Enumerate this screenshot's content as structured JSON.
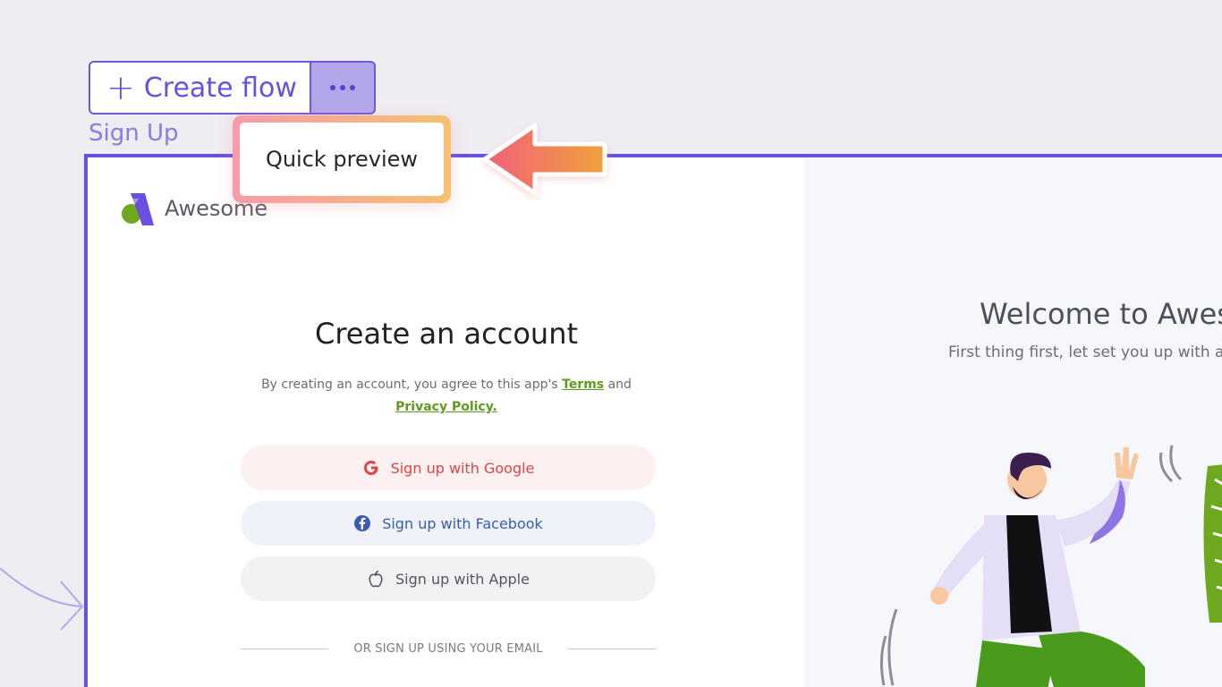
{
  "toolbar": {
    "create_label": "Create flow",
    "plus_glyph": "+",
    "more_icon": "more-horizontal-icon"
  },
  "flow": {
    "label": "Sign Up"
  },
  "tooltip": {
    "text": "Quick preview"
  },
  "preview": {
    "logo_text": "Awesome",
    "heading": "Create an account",
    "terms_prefix": "By creating an account, you agree to this app's",
    "terms_link": "Terms",
    "terms_and": "and",
    "privacy_link": "Privacy Policy.",
    "google_label": "Sign up with Google",
    "facebook_label": "Sign up with Facebook",
    "apple_label": "Sign up with Apple",
    "divider_text": "OR SIGN UP USING YOUR EMAIL",
    "welcome_title": "Welcome to Awes",
    "welcome_sub": "First thing first, let set you up with an"
  },
  "colors": {
    "accent": "#6b4fe0",
    "link_green": "#5e9a1f",
    "google_red": "#e04545",
    "facebook_blue": "#3a5bb0",
    "arrow_start": "#f35f7a",
    "arrow_end": "#eea23b"
  }
}
